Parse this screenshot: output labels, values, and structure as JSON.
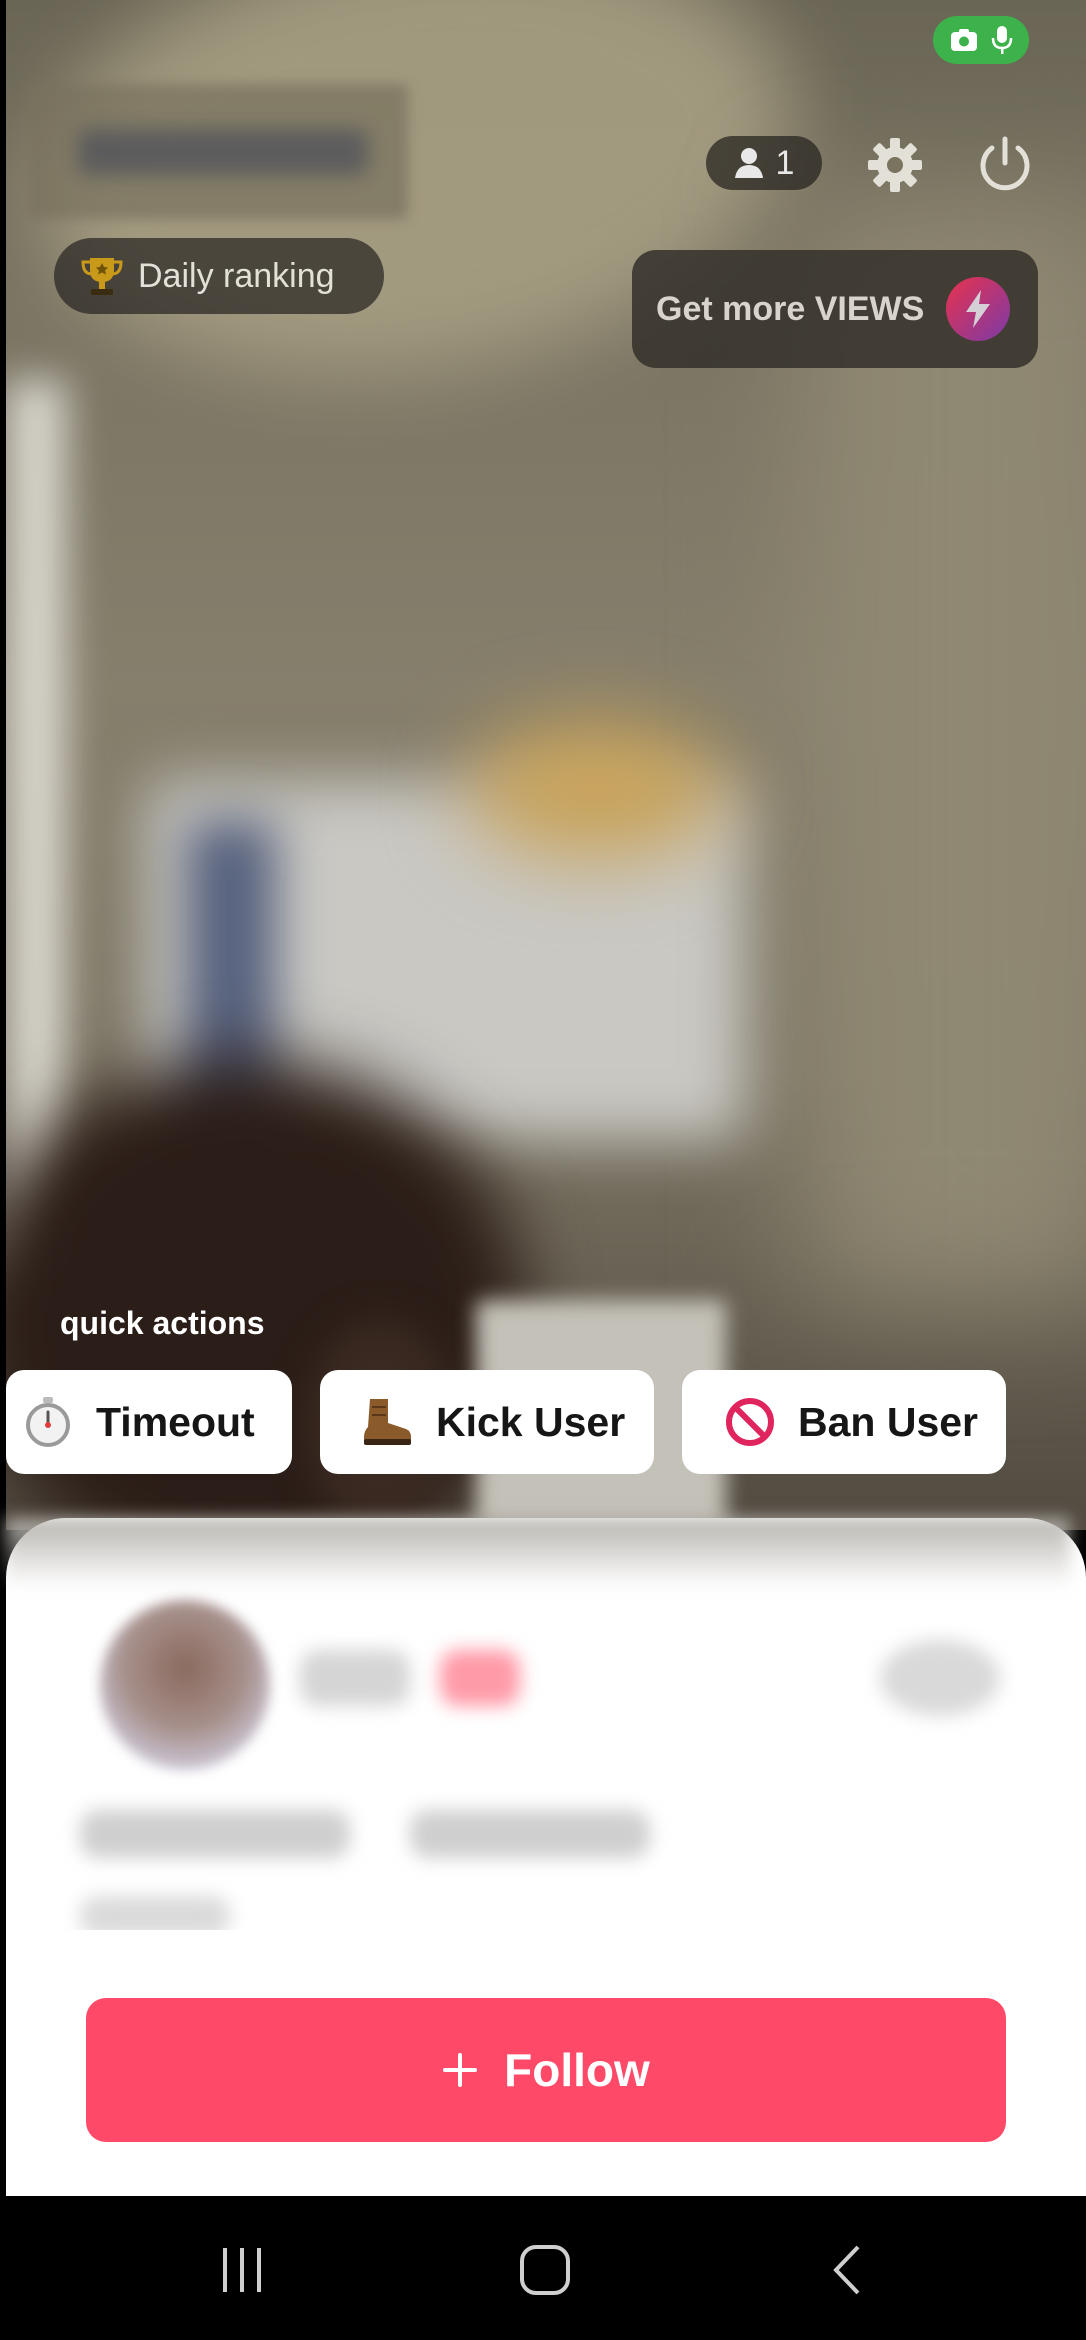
{
  "stream": {
    "viewer_count": "1",
    "daily_ranking_label": "Daily ranking",
    "get_more_views_label": "Get more VIEWS"
  },
  "quick_actions": {
    "title": "quick actions",
    "buttons": [
      {
        "label": "Timeout",
        "icon": "stopwatch-icon"
      },
      {
        "label": "Kick User",
        "icon": "boot-icon"
      },
      {
        "label": "Ban User",
        "icon": "prohibited-icon"
      }
    ]
  },
  "profile": {
    "follow_label": "Follow"
  },
  "colors": {
    "accent": "#fe4a68",
    "status_green": "#3db24b",
    "trophy": "#c99a1a"
  }
}
